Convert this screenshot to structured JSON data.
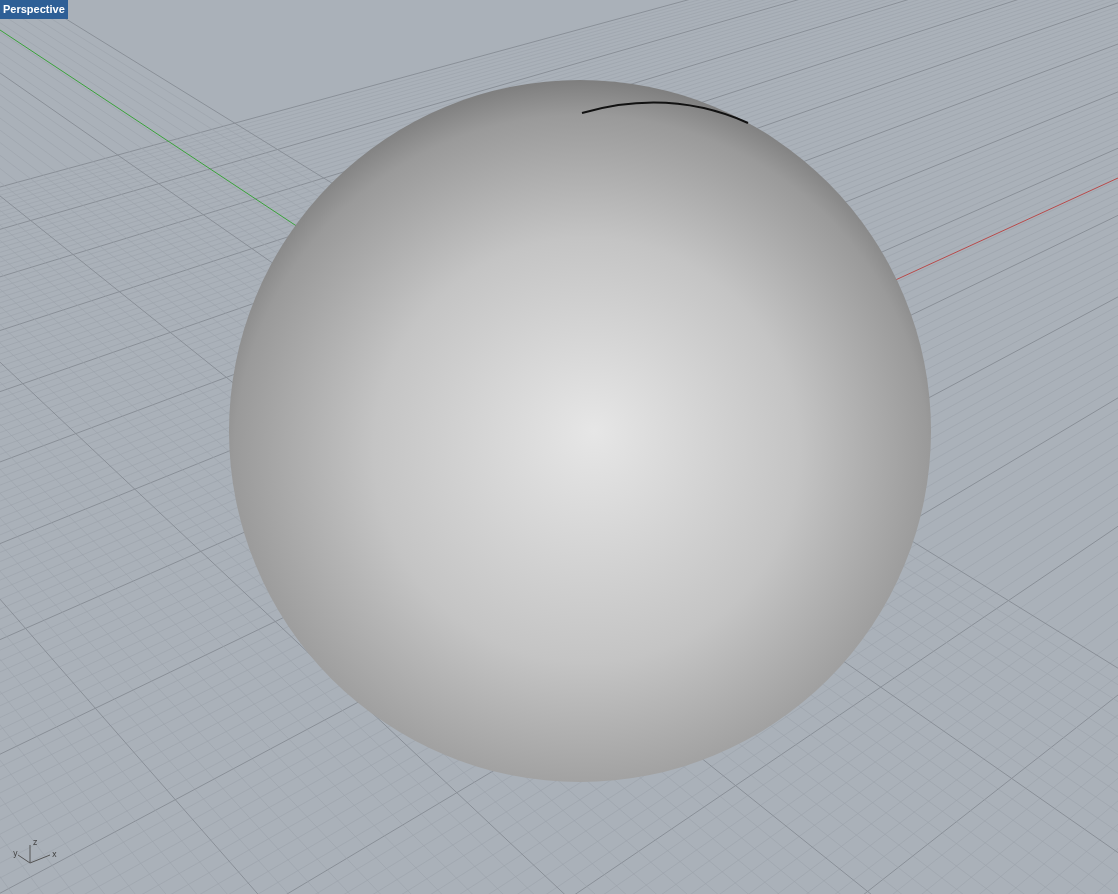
{
  "viewport": {
    "title": "Perspective"
  },
  "axis_gizmo": {
    "x_label": "x",
    "y_label": "y",
    "z_label": "z"
  }
}
